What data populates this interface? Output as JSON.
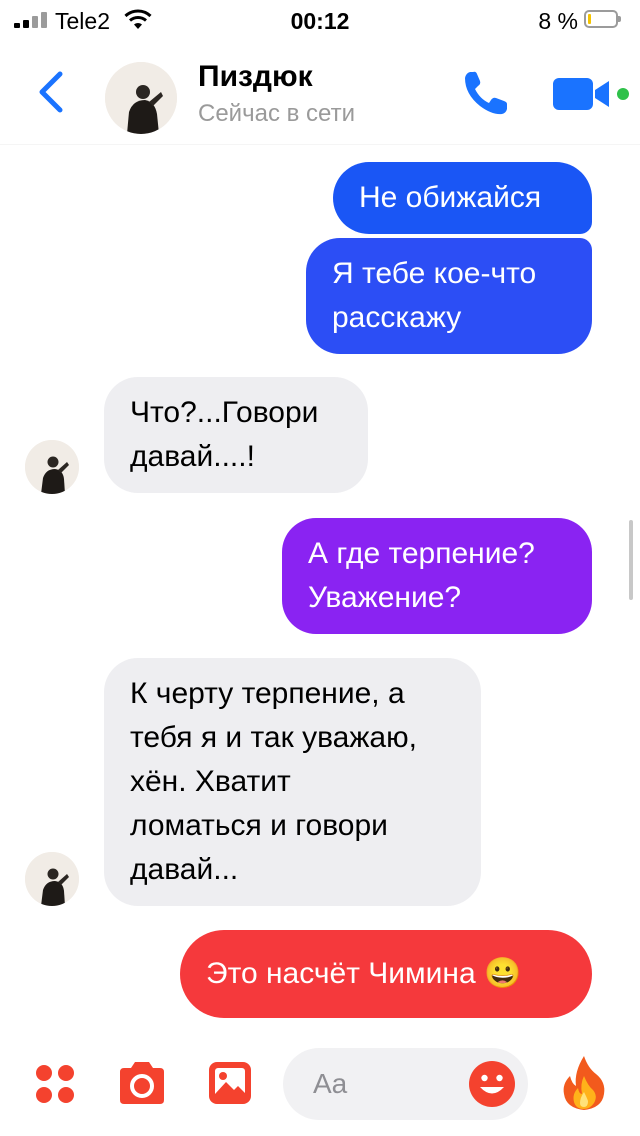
{
  "status_bar": {
    "carrier": "Tele2",
    "time": "00:12",
    "battery_percent": "8 %",
    "battery_level": 0.08
  },
  "header": {
    "contact_name": "Пиздюк",
    "contact_status": "Сейчас в сети",
    "online_color": "#2fc14a",
    "accent_color": "#1a73ff"
  },
  "messages": [
    {
      "direction": "outgoing",
      "lines": [
        "Не обижайся"
      ],
      "color": "#1a56f5"
    },
    {
      "direction": "outgoing",
      "lines": [
        "Я тебе кое-что",
        "расскажу"
      ],
      "color": "#2c4ef5"
    },
    {
      "direction": "incoming",
      "lines": [
        "Что?...Говори",
        "давай....!"
      ]
    },
    {
      "direction": "outgoing",
      "lines": [
        "А где терпение?",
        "Уважение?"
      ],
      "color": "#8a23f2"
    },
    {
      "direction": "incoming",
      "lines": [
        "К черту терпение, а",
        "тебя я и так уважаю,",
        "хён. Хватит",
        "ломаться и говори",
        "давай..."
      ]
    },
    {
      "direction": "outgoing",
      "lines": [
        "Это насчёт Чимина 😀"
      ],
      "color": "#f5393c"
    }
  ],
  "input_bar": {
    "placeholder": "Aa",
    "icons": [
      "menu-dots-icon",
      "camera-icon",
      "gallery-icon",
      "emoji-icon",
      "fire-icon"
    ],
    "accent_color": "#f4422e"
  }
}
